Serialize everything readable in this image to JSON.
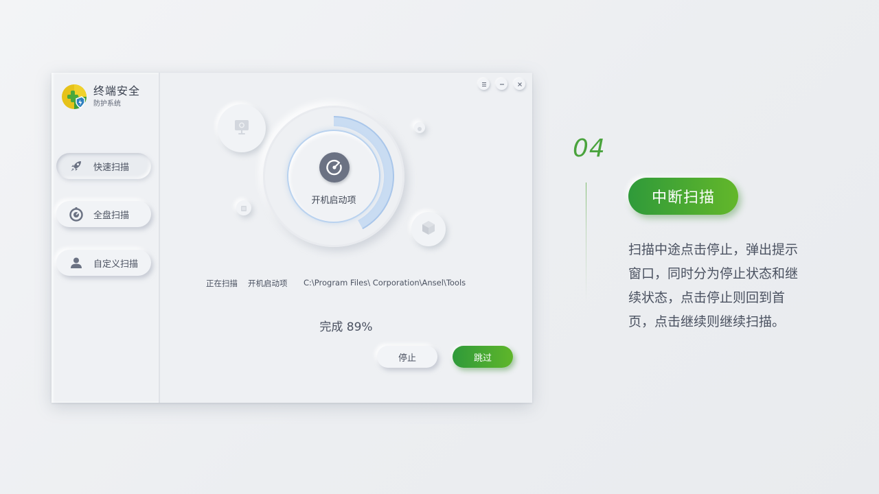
{
  "app": {
    "title": "终端安全",
    "subtitle": "防护系统"
  },
  "sidebar": {
    "items": [
      {
        "label": "快速扫描",
        "icon": "rocket-icon",
        "active": true
      },
      {
        "label": "全盘扫描",
        "icon": "gauge-icon",
        "active": false
      },
      {
        "label": "自定义扫描",
        "icon": "user-icon",
        "active": false
      }
    ]
  },
  "window_controls": {
    "menu": "menu-icon",
    "minimize": "minimize-icon",
    "close": "close-icon"
  },
  "scan": {
    "center_label": "开机启动项",
    "status_prefix": "正在扫描",
    "current_item": "开机启动项",
    "current_path": "C:\\Program Files\\ Corporation\\Ansel\\Tools",
    "complete_text": "完成 89%",
    "progress": 0.89
  },
  "buttons": {
    "stop": "停止",
    "skip": "跳过"
  },
  "colors": {
    "accent_green": "#3fa235",
    "progress_blue": "#bcd4f0",
    "icon_gray": "#6b7283"
  },
  "panel": {
    "step_number": "04",
    "title": "中断扫描",
    "description": "扫描中途点击停止，弹出提示窗口，同时分为停止状态和继续状态，点击停止则回到首页，点击继续则继续扫描。"
  }
}
